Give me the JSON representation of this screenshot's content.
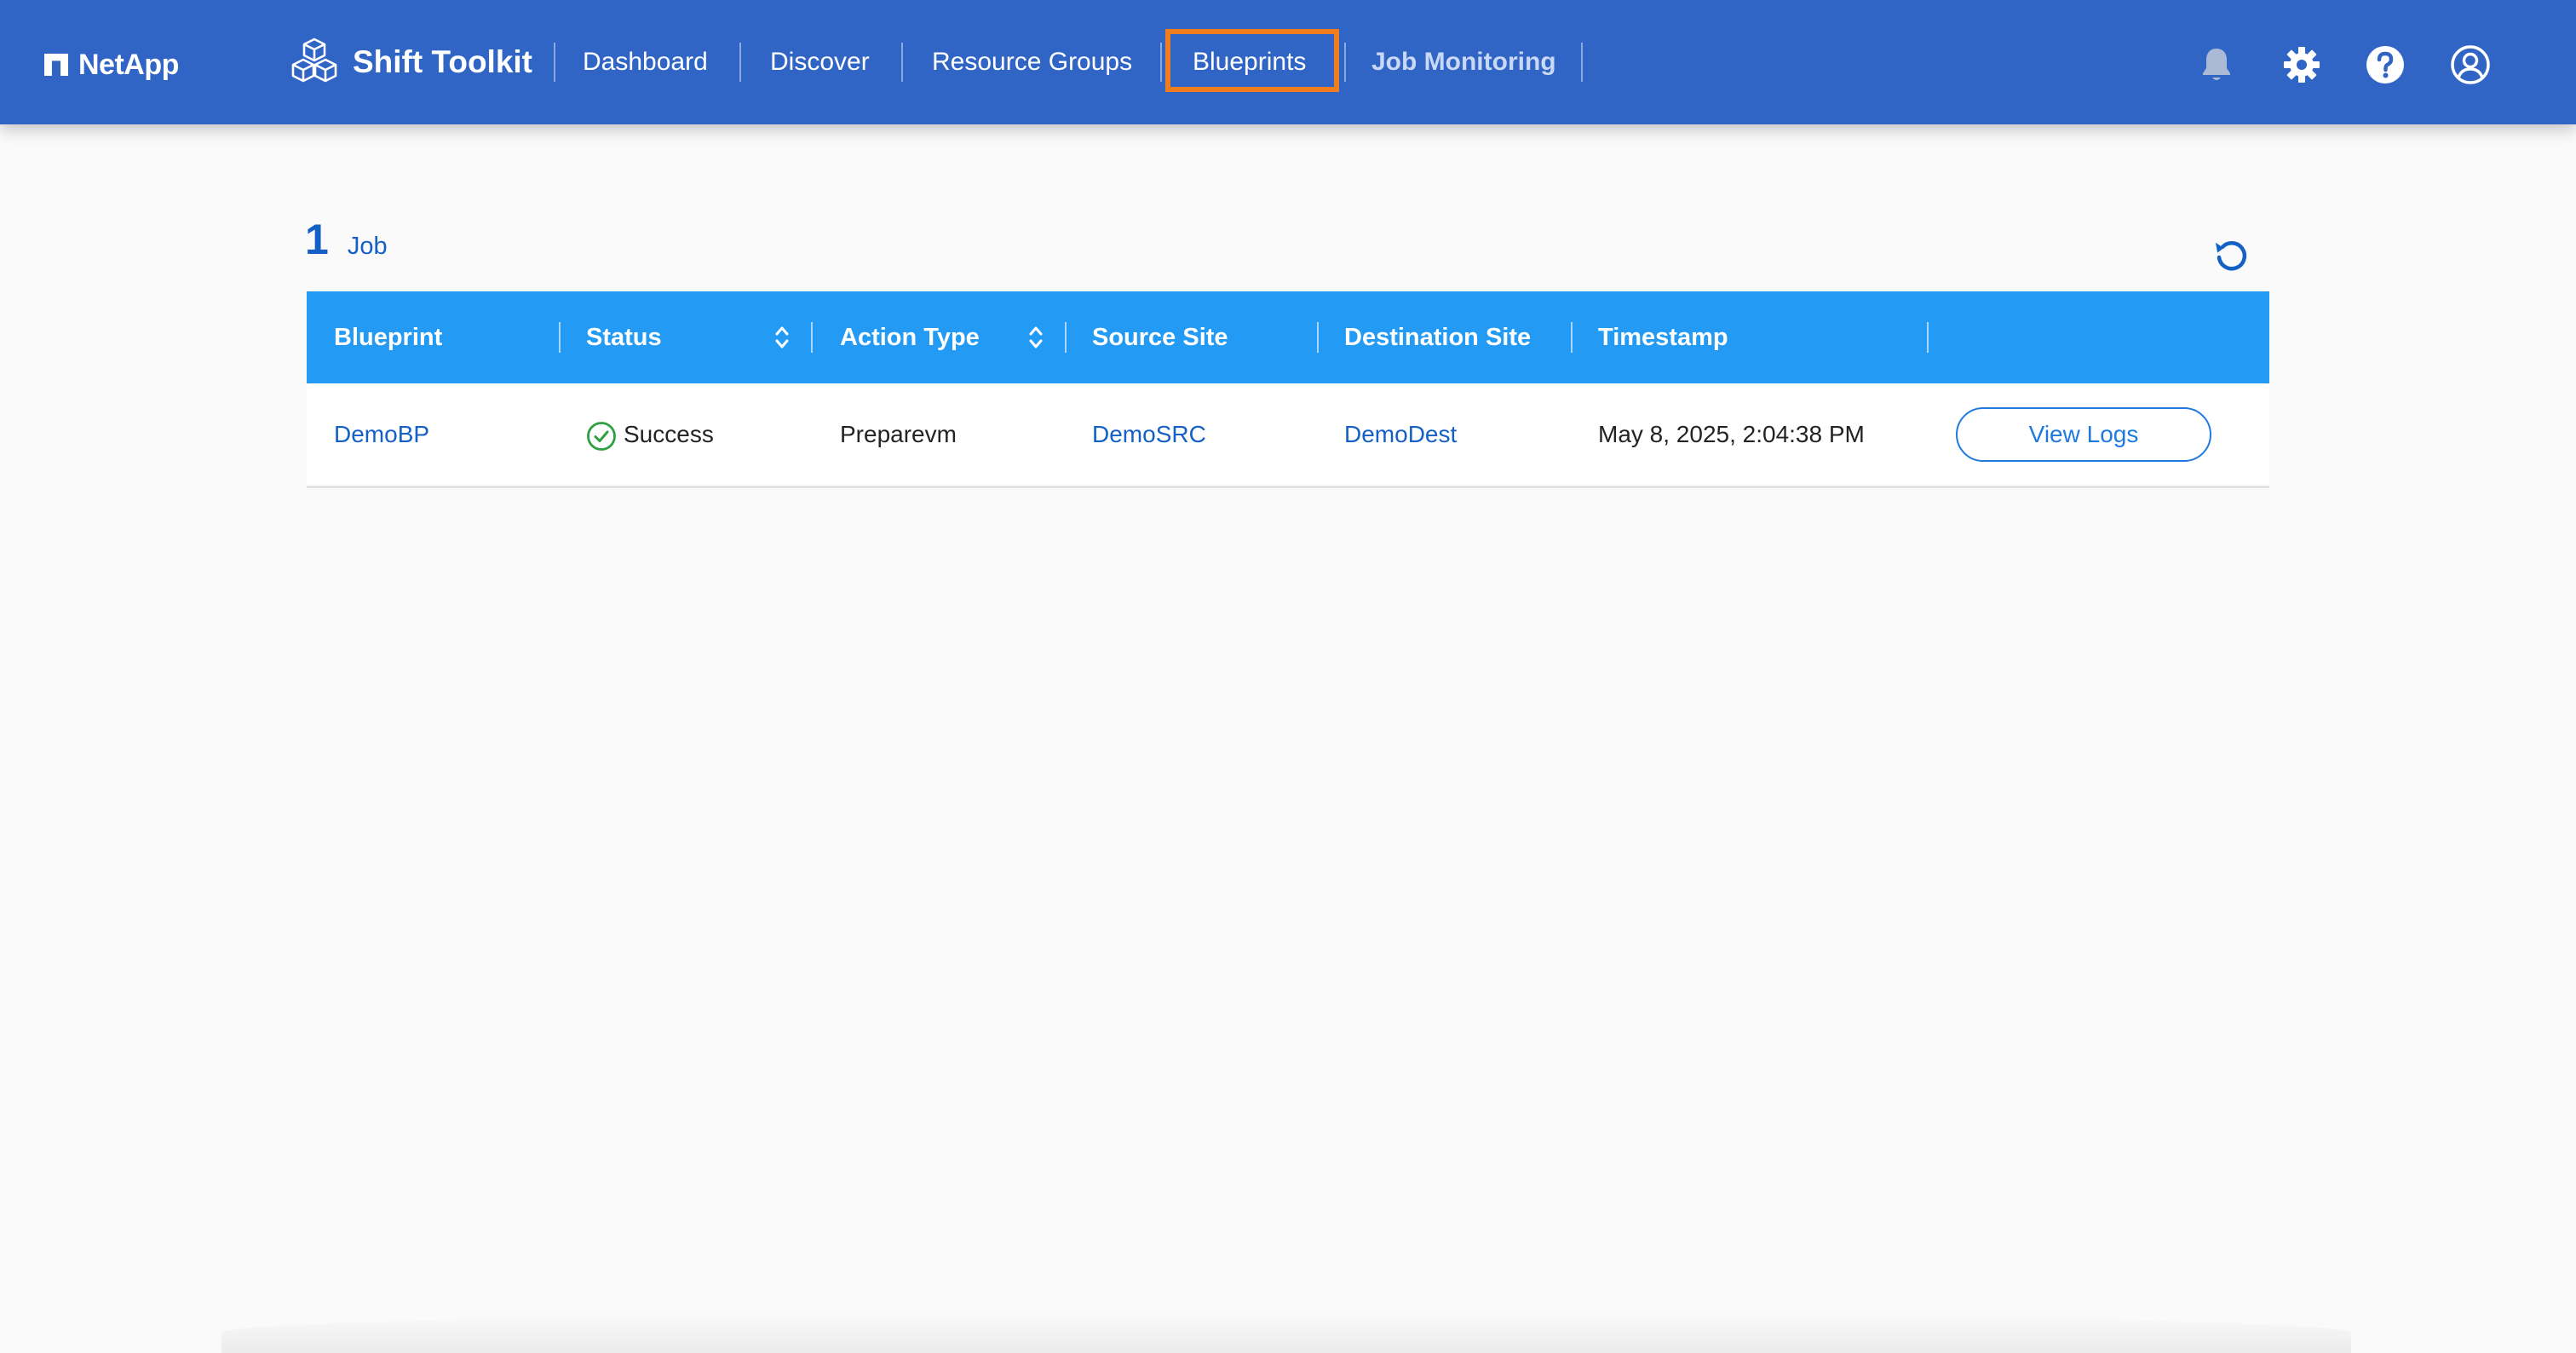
{
  "header": {
    "brand": "NetApp",
    "product": "Shift Toolkit",
    "nav": [
      {
        "label": "Dashboard"
      },
      {
        "label": "Discover"
      },
      {
        "label": "Resource Groups"
      },
      {
        "label": "Blueprints"
      },
      {
        "label": "Job Monitoring"
      }
    ],
    "icons": [
      "bell-icon",
      "gear-icon",
      "help-icon",
      "user-icon"
    ],
    "colors": {
      "header_bg": "#3065c6",
      "highlight": "#f07d1e",
      "active_nav": "#c9d8f5"
    }
  },
  "jobs": {
    "count": "1",
    "count_label": "Job"
  },
  "table": {
    "headers": [
      "Blueprint",
      "Status",
      "Action Type",
      "Source Site",
      "Destination Site",
      "Timestamp"
    ],
    "rows": [
      {
        "blueprint": "DemoBP",
        "status": "Success",
        "action_type": "Preparevm",
        "source_site": "DemoSRC",
        "destination_site": "DemoDest",
        "timestamp": "May 8, 2025, 2:04:38 PM",
        "action_label": "View Logs"
      }
    ],
    "colors": {
      "header_bg": "#239bf4",
      "link": "#1560c4",
      "success": "#2ea043"
    }
  }
}
